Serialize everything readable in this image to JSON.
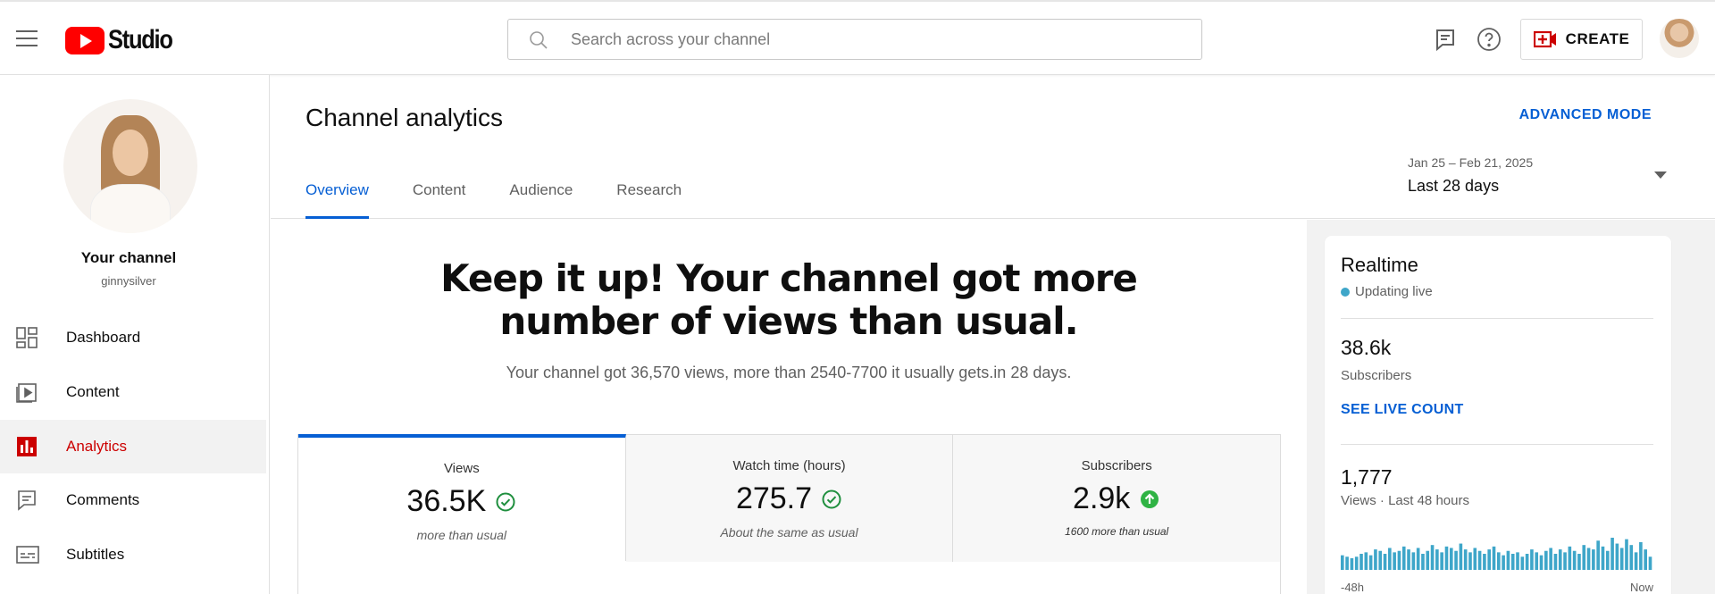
{
  "header": {
    "logo_text": "Studio",
    "search_placeholder": "Search across your channel",
    "create_label": "CREATE",
    "icons": [
      "menu-icon",
      "feedback-icon",
      "help-icon",
      "create-video-icon"
    ]
  },
  "sidebar": {
    "channel_title": "Your channel",
    "channel_handle": "ginnysilver",
    "items": [
      {
        "label": "Dashboard",
        "icon": "dashboard-icon",
        "active": false
      },
      {
        "label": "Content",
        "icon": "content-icon",
        "active": false
      },
      {
        "label": "Analytics",
        "icon": "analytics-icon",
        "active": true
      },
      {
        "label": "Comments",
        "icon": "comments-icon",
        "active": false
      },
      {
        "label": "Subtitles",
        "icon": "subtitles-icon",
        "active": false
      }
    ]
  },
  "main": {
    "title": "Channel analytics",
    "advanced_mode": "ADVANCED MODE",
    "tabs": [
      {
        "label": "Overview",
        "active": true
      },
      {
        "label": "Content",
        "active": false
      },
      {
        "label": "Audience",
        "active": false
      },
      {
        "label": "Research",
        "active": false
      }
    ],
    "date_range": {
      "dates": "Jan 25 – Feb 21, 2025",
      "label": "Last 28 days"
    },
    "headline": "Keep it up! Your channel got more number of views than usual.",
    "subline": "Your channel got 36,570 views, more than 2540-7700 it usually gets.in 28 days.",
    "cards": [
      {
        "label": "Views",
        "value": "36.5K",
        "note": "more than usual",
        "status": "check",
        "active": true
      },
      {
        "label": "Watch time (hours)",
        "value": "275.7",
        "note": "About the same as usual",
        "status": "check",
        "active": false
      },
      {
        "label": "Subscribers",
        "value": "2.9k",
        "note": "1600 more than usual",
        "status": "up",
        "active": false
      }
    ]
  },
  "realtime": {
    "title": "Realtime",
    "status": "Updating live",
    "subscribers_value": "38.6k",
    "subscribers_label": "Subscribers",
    "live_count_link": "SEE LIVE COUNT",
    "views_value": "1,777",
    "views_label": "Views · Last 48 hours",
    "axis_start": "-48h",
    "axis_end": "Now",
    "bars": [
      10,
      9,
      8,
      9,
      11,
      12,
      10,
      14,
      13,
      11,
      15,
      12,
      13,
      16,
      14,
      12,
      15,
      11,
      13,
      17,
      14,
      12,
      16,
      15,
      13,
      18,
      14,
      12,
      15,
      13,
      11,
      14,
      16,
      12,
      10,
      13,
      11,
      12,
      9,
      11,
      14,
      12,
      10,
      13,
      15,
      11,
      14,
      12,
      16,
      13,
      11,
      17,
      15,
      14,
      20,
      16,
      13,
      22,
      18,
      15,
      21,
      17,
      12,
      19,
      14,
      9
    ],
    "bar_color": "#3ea6c9"
  },
  "colors": {
    "accent": "#065fd4",
    "brand_red": "#ff0000",
    "active_nav": "#cc0000",
    "check_green": "#1f8f3e",
    "up_green": "#2fb344"
  }
}
